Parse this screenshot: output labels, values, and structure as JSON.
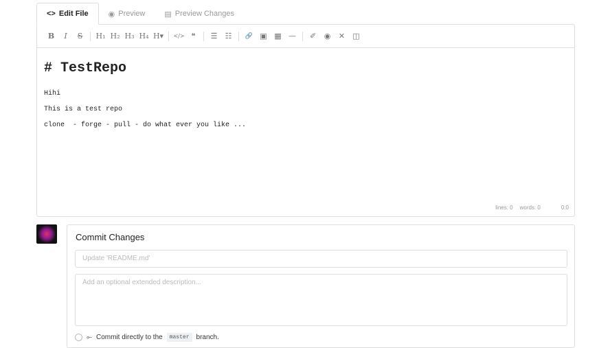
{
  "tabs": [
    {
      "label": "Edit File",
      "icon": "code-icon"
    },
    {
      "label": "Preview",
      "icon": "eye-icon"
    },
    {
      "label": "Preview Changes",
      "icon": "diff-icon"
    }
  ],
  "toolbar": {
    "bold": "B",
    "italic": "I",
    "strike": "S",
    "h1": "H₁",
    "h2": "H₂",
    "h3": "H₃",
    "h4": "H₄",
    "h5": "H▾",
    "code": "</>",
    "quote": "❝",
    "ul": "☰",
    "ol": "☷",
    "link": "🔗",
    "image": "▣",
    "table": "▦",
    "hr": "—",
    "eraser": "✐",
    "preview": "◉",
    "fullscreen": "✕",
    "side": "◫"
  },
  "editor": {
    "heading": "# TestRepo",
    "lines": [
      "Hihi",
      "This is a test repo",
      "clone  - forge - pull - do what ever you like ..."
    ],
    "status_lines": "lines: 0",
    "status_words": "words: 0",
    "status_cursor": "0:0"
  },
  "commit": {
    "title": "Commit Changes",
    "summary_placeholder": "Update 'README.md'",
    "description_placeholder": "Add an optional extended description...",
    "option_prefix": "Commit directly to the",
    "branch": "master",
    "option_suffix": "branch."
  }
}
